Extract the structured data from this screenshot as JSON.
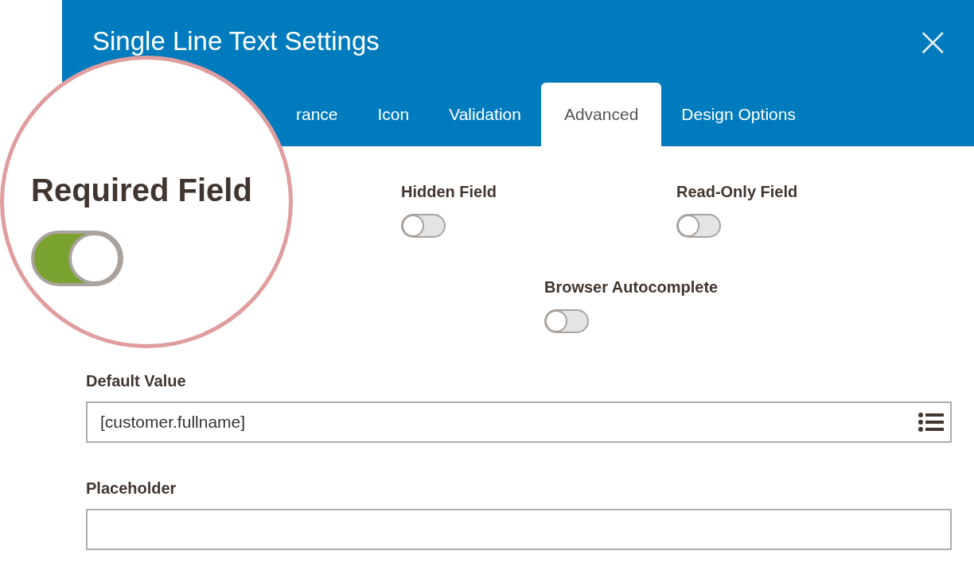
{
  "modal": {
    "title": "Single Line Text Settings",
    "close": "×"
  },
  "tabs": [
    {
      "label": "rance",
      "selected": false
    },
    {
      "label": "Icon",
      "selected": false
    },
    {
      "label": "Validation",
      "selected": false
    },
    {
      "label": "Advanced",
      "selected": true
    },
    {
      "label": "Design Options",
      "selected": false
    }
  ],
  "toggles": [
    [
      {
        "label": "Hidden Field",
        "on": false
      },
      {
        "label": "Read-Only Field",
        "on": false
      }
    ],
    [
      {
        "label": "Browser Autocomplete",
        "on": false
      }
    ]
  ],
  "fields": [
    {
      "label": "Default Value",
      "value": "[customer.fullname]",
      "has_list_icon": true
    },
    {
      "label": "Placeholder",
      "has_list_icon": false
    }
  ],
  "magnifier": {
    "label": "Required Field",
    "on": true
  }
}
